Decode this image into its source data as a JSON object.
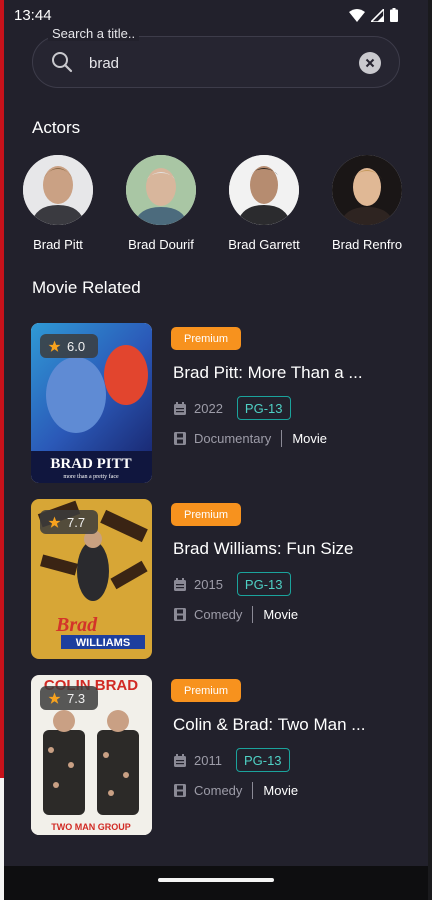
{
  "status_bar": {
    "time": "13:44"
  },
  "search": {
    "label": "Search a title..",
    "value": "brad"
  },
  "actors_section": {
    "title": "Actors",
    "actors": [
      {
        "name": "Brad Pitt"
      },
      {
        "name": "Brad Dourif"
      },
      {
        "name": "Brad Garrett"
      },
      {
        "name": "Brad Renfro"
      }
    ]
  },
  "movies_section": {
    "title": "Movie Related",
    "movies": [
      {
        "rating": "6.0",
        "badge": "Premium",
        "title": "Brad Pitt: More Than a ...",
        "year": "2022",
        "certification": "PG-13",
        "genre": "Documentary",
        "type": "Movie",
        "poster_text": "BRAD PITT",
        "poster_subtext": "more than a pretty face"
      },
      {
        "rating": "7.7",
        "badge": "Premium",
        "title": "Brad Williams: Fun Size",
        "year": "2015",
        "certification": "PG-13",
        "genre": "Comedy",
        "type": "Movie",
        "poster_text": "Brad",
        "poster_subtext": "WILLIAMS"
      },
      {
        "rating": "7.3",
        "badge": "Premium",
        "title": "Colin & Brad: Two Man ...",
        "year": "2011",
        "certification": "PG-13",
        "genre": "Comedy",
        "type": "Movie",
        "poster_text": "COLIN BRAD",
        "poster_subtext": "TWO MAN GROUP"
      }
    ]
  },
  "colors": {
    "background": "#22212c",
    "premium": "#f7921e",
    "certification": "#1ba39c",
    "accent_edge": "#c7121b"
  }
}
